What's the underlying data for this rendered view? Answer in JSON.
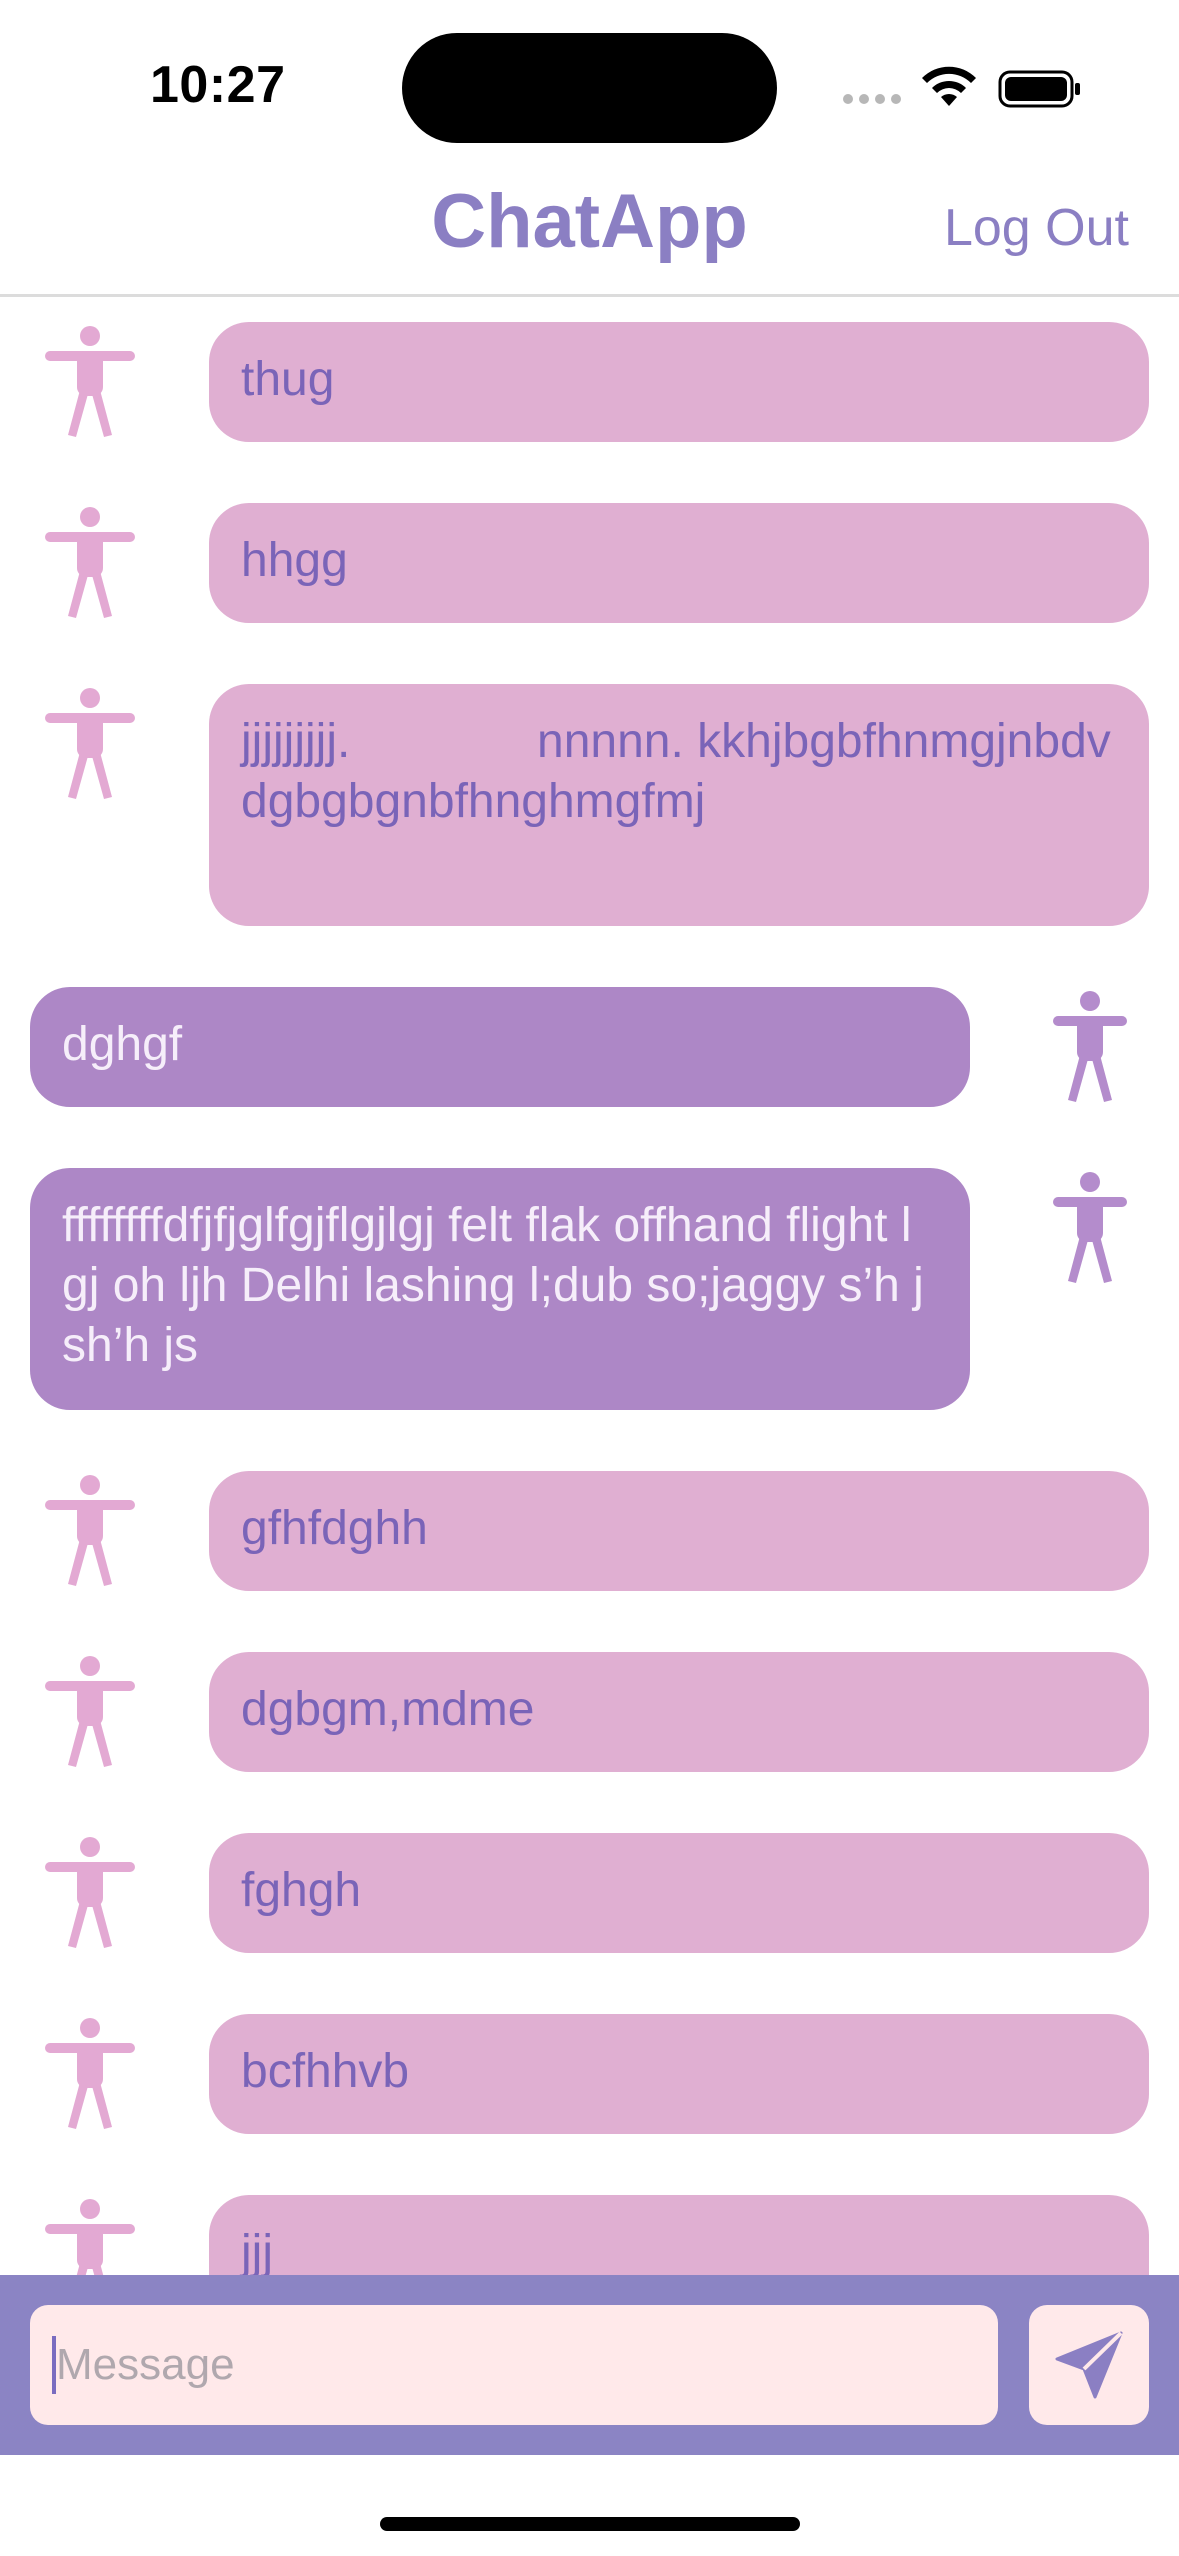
{
  "status_bar": {
    "time": "10:27"
  },
  "nav": {
    "title": "ChatApp",
    "logout_label": "Log Out"
  },
  "colors": {
    "accent": "#8b7fc3",
    "incoming_bubble": "#e0afd2",
    "incoming_text": "#7a64b8",
    "outgoing_bubble": "#ad87c6",
    "outgoing_text": "#f6eefa",
    "input_bar": "#8b84c4",
    "input_field": "#ffe9ea",
    "avatar_incoming": "#e3a9d3",
    "avatar_outgoing": "#b48ccc"
  },
  "messages": [
    {
      "direction": "incoming",
      "text": "thug",
      "avatar_icon": "person-icon"
    },
    {
      "direction": "incoming",
      "text": "hhgg",
      "avatar_icon": "person-icon"
    },
    {
      "direction": "incoming",
      "text": "jjjjjjjjj.              nnnnn. kkhjbgbfhnmgjnbdvdgbgbgnbfhnghmgfmj",
      "avatar_icon": "person-icon"
    },
    {
      "direction": "outgoing",
      "text": "dghgf",
      "avatar_icon": "person-icon"
    },
    {
      "direction": "outgoing",
      "text": "ffffffffdfjfjglfgjflgjlgj felt flak offhand flight lgj oh ljh Delhi lashing l;dub so;jaggy s’h jsh’h js",
      "avatar_icon": "person-icon"
    },
    {
      "direction": "incoming",
      "text": "gfhfdghh",
      "avatar_icon": "person-icon"
    },
    {
      "direction": "incoming",
      "text": "dgbgm,mdme",
      "avatar_icon": "person-icon"
    },
    {
      "direction": "incoming",
      "text": "fghgh",
      "avatar_icon": "person-icon"
    },
    {
      "direction": "incoming",
      "text": "bcfhhvb",
      "avatar_icon": "person-icon"
    },
    {
      "direction": "incoming",
      "text": "jjj",
      "avatar_icon": "person-icon"
    }
  ],
  "composer": {
    "placeholder": "Message",
    "value": "",
    "send_icon": "send-icon"
  }
}
